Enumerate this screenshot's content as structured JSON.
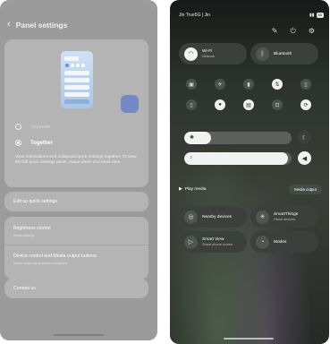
{
  "left_screen": {
    "title": "Panel settings",
    "back_icon": "arrow-left-icon",
    "options": [
      {
        "label": "Separate",
        "selected": false
      },
      {
        "label": "Together",
        "selected": true
      }
    ],
    "description": "View notifications and collapsed quick settings together. To view the full quick settings panel, swipe down one more time.",
    "edit_quick_settings": "Edit up quick settings",
    "brightness": {
      "title": "Brightness control",
      "sub": "Show always"
    },
    "device_control": {
      "title": "Device control and Media output buttons",
      "sub": "Show when quick panel collapsed"
    },
    "contact_us": "Contact us"
  },
  "right_screen": {
    "carrier": "Jio True5G | Jio",
    "battery": "85",
    "top_icons": [
      "pencil-icon",
      "power-icon",
      "gear-icon"
    ],
    "tiles": {
      "wifi": {
        "label": "Wi-Fi",
        "sub": "Network",
        "icon": "wifi-icon",
        "on": true
      },
      "bluetooth": {
        "label": "Bluetooth",
        "sub": "",
        "icon": "bluetooth-icon",
        "on": false
      }
    },
    "quick_toggles": [
      "vibrate-icon",
      "airplane-icon",
      "torch-icon",
      "data-icon",
      "battery-icon",
      "location-icon",
      "dnd-icon",
      "screenshot-icon",
      "sync-icon"
    ],
    "play_media": "Play media",
    "media_output": "Media output",
    "bottom_tiles": {
      "nearby": {
        "label": "Nearby devices"
      },
      "smartthings": {
        "label": "SmartThings",
        "sub": "Home devices"
      },
      "smartview": {
        "label": "Smart View",
        "sub": "Share phone screen"
      },
      "modes": {
        "label": "Modes"
      }
    },
    "brightness_level": 0.25,
    "volume_level": 0.97
  }
}
